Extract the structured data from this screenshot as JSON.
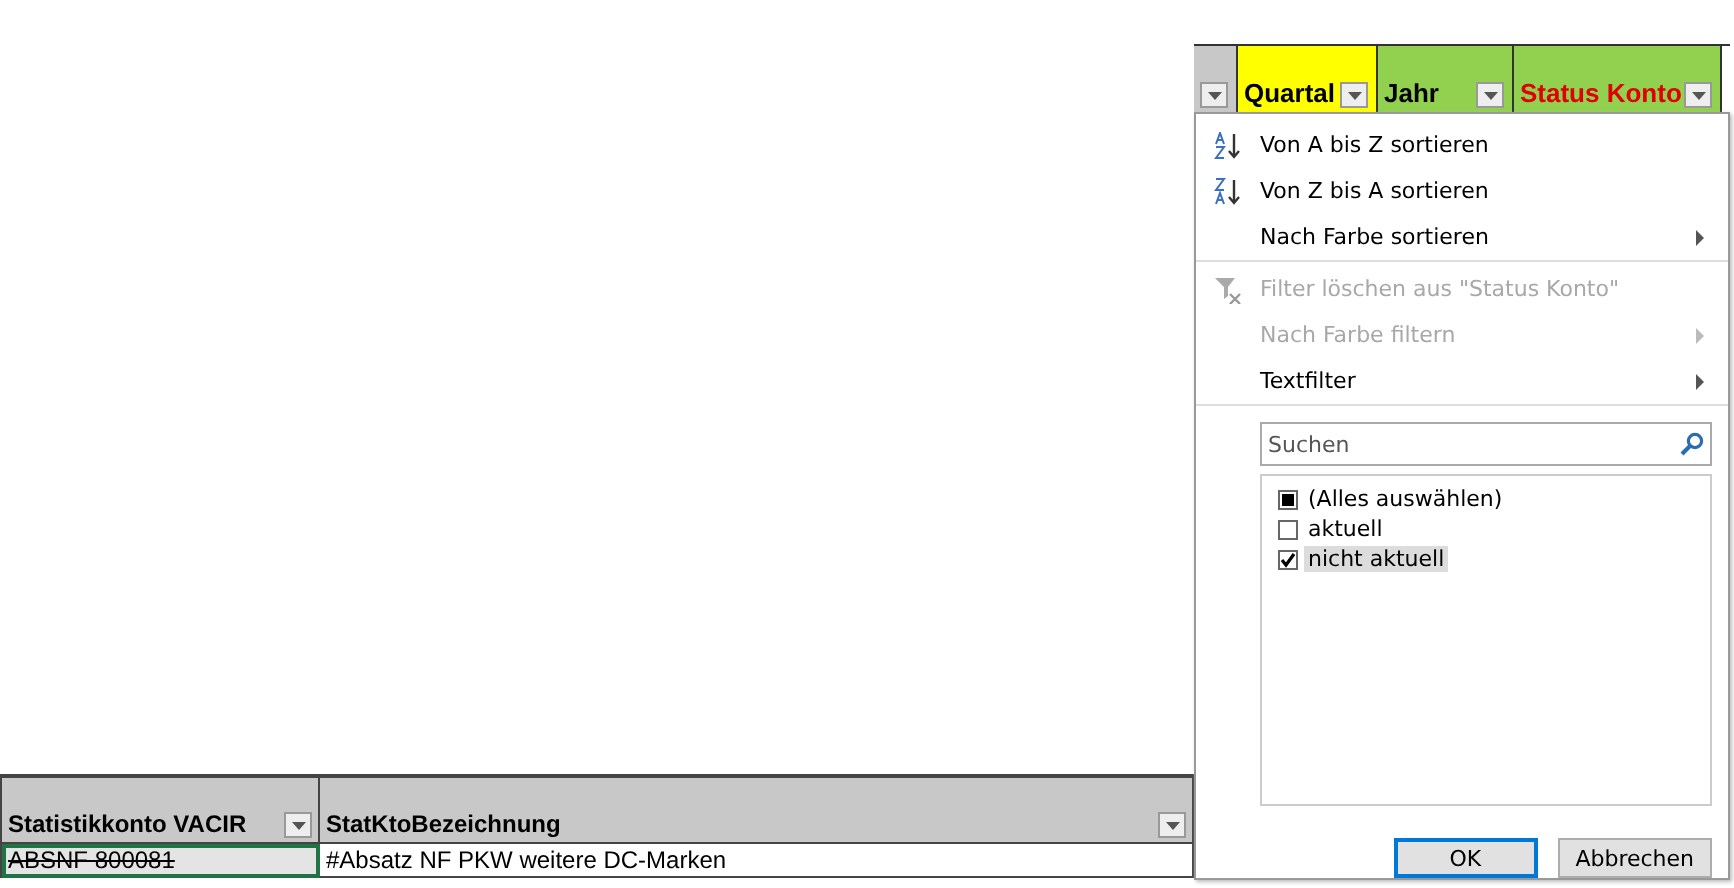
{
  "sheet_table": {
    "columns": [
      {
        "label": "Statistikkonto VACIR"
      },
      {
        "label": "StatKtoBezeichnung"
      }
    ],
    "rows": [
      [
        {
          "text": "ABSNF  800081",
          "strikethrough": true,
          "selected": true
        },
        {
          "text": "#Absatz NF  PKW weitere DC-Marken",
          "strikethrough": false,
          "selected": false
        }
      ]
    ]
  },
  "filter_header": {
    "columns": [
      {
        "color": "#c8c8c8"
      },
      {
        "label": "Quartal",
        "color": "#ffff00",
        "alert": false
      },
      {
        "label": "Jahr",
        "color": "#92d050",
        "alert": false
      },
      {
        "label": "Status Konto",
        "color": "#92d050",
        "alert": true
      }
    ]
  },
  "filter_menu": {
    "items": [
      {
        "kind": "sort-ascending",
        "label": "Von A bis Z sortieren",
        "disabled": false,
        "submenu": false,
        "separator_after": false
      },
      {
        "kind": "sort-descending",
        "label": "Von Z bis A sortieren",
        "disabled": false,
        "submenu": false,
        "separator_after": false
      },
      {
        "kind": "plain",
        "label": "Nach Farbe sortieren",
        "disabled": false,
        "submenu": true,
        "separator_after": true
      },
      {
        "kind": "clear-filter",
        "label": "Filter löschen aus \"Status Konto\"",
        "disabled": true,
        "submenu": false,
        "separator_after": false
      },
      {
        "kind": "plain",
        "label": "Nach Farbe filtern",
        "disabled": true,
        "submenu": true,
        "separator_after": false
      },
      {
        "kind": "plain",
        "label": "Textfilter",
        "disabled": false,
        "submenu": true,
        "separator_after": true
      }
    ],
    "search": {
      "placeholder": "Suchen"
    },
    "values": [
      {
        "label": "(Alles auswählen)",
        "checked": true,
        "partial": true,
        "selected": false
      },
      {
        "label": "aktuell",
        "checked": false,
        "selected": false
      },
      {
        "label": "nicht aktuell",
        "checked": true,
        "selected": true
      }
    ],
    "buttons": [
      {
        "label": "OK",
        "default": true
      },
      {
        "label": "Abbrechen",
        "default": false
      }
    ]
  }
}
